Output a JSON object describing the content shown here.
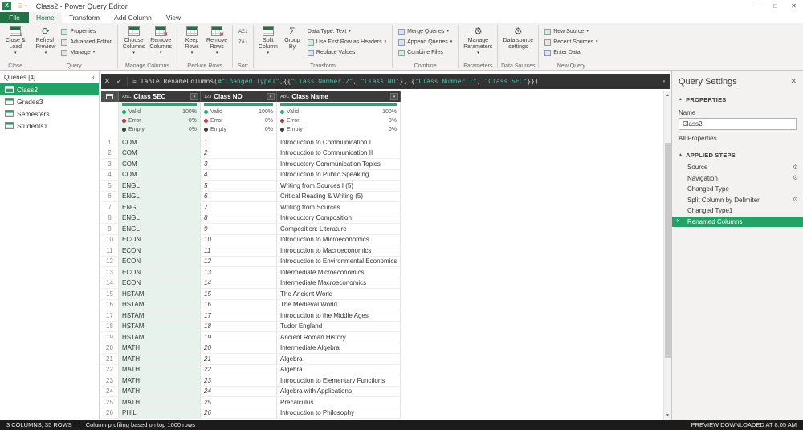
{
  "colors": {
    "accent_green": "#217346",
    "selection_green": "#21a366",
    "formula_string_teal": "#45c2a9",
    "valid_green": "#1aab6d",
    "error_red": "#c13838",
    "empty_dark": "#3b3b3b",
    "table_header_gray": "#3b3b3b"
  },
  "window": {
    "title": "Class2 - Power Query Editor"
  },
  "tabs": {
    "file": "File",
    "home": "Home",
    "transform": "Transform",
    "add_column": "Add Column",
    "view": "View"
  },
  "ribbon": {
    "close": {
      "label": "Close",
      "close_load": "Close &\nLoad"
    },
    "query": {
      "label": "Query",
      "refresh": "Refresh\nPreview",
      "properties": "Properties",
      "advanced_editor": "Advanced Editor",
      "manage": "Manage"
    },
    "manage_columns": {
      "label": "Manage Columns",
      "choose_columns": "Choose\nColumns",
      "remove_columns": "Remove\nColumns"
    },
    "reduce_rows": {
      "label": "Reduce Rows",
      "keep_rows": "Keep\nRows",
      "remove_rows": "Remove\nRows"
    },
    "sort": {
      "label": "Sort"
    },
    "transform": {
      "label": "Transform",
      "split_column": "Split\nColumn",
      "group_by": "Group\nBy",
      "data_type": "Data Type: Text",
      "use_first_row": "Use First Row as Headers",
      "replace_values": "Replace Values"
    },
    "combine": {
      "label": "Combine",
      "merge_queries": "Merge Queries",
      "append_queries": "Append Queries",
      "combine_files": "Combine Files"
    },
    "parameters": {
      "label": "Parameters",
      "manage_parameters": "Manage\nParameters"
    },
    "data_sources": {
      "label": "Data Sources",
      "data_source_settings": "Data source\nsettings"
    },
    "new_query": {
      "label": "New Query",
      "new_source": "New Source",
      "recent_sources": "Recent Sources",
      "enter_data": "Enter Data"
    }
  },
  "queries_pane": {
    "header": "Queries [4]",
    "items": [
      {
        "label": "Class2",
        "selected": true
      },
      {
        "label": "Grades3",
        "selected": false
      },
      {
        "label": "Semesters",
        "selected": false
      },
      {
        "label": "Students1",
        "selected": false
      }
    ]
  },
  "formula_bar": {
    "tokens": [
      {
        "text": "= Table.RenameColumns(",
        "type": "plain"
      },
      {
        "text": "#\"Changed Type1\"",
        "type": "string"
      },
      {
        "text": ",{{",
        "type": "plain"
      },
      {
        "text": "\"Class Number.2\"",
        "type": "string"
      },
      {
        "text": ", ",
        "type": "plain"
      },
      {
        "text": "\"Class NO\"",
        "type": "string"
      },
      {
        "text": "}, {",
        "type": "plain"
      },
      {
        "text": "\"Class Number.1\"",
        "type": "string"
      },
      {
        "text": ", ",
        "type": "plain"
      },
      {
        "text": "\"Class SEC\"",
        "type": "string"
      },
      {
        "text": "}})",
        "type": "plain"
      }
    ]
  },
  "table": {
    "quality_labels": {
      "valid": "Valid",
      "error": "Error",
      "empty": "Empty"
    },
    "columns": [
      {
        "type_label": "ABC",
        "name": "Class SEC",
        "valid": "100%",
        "error": "0%",
        "empty": "0%"
      },
      {
        "type_label": "123",
        "name": "Class NO",
        "valid": "100%",
        "error": "0%",
        "empty": "0%"
      },
      {
        "type_label": "ABC",
        "name": "Class Name",
        "valid": "100%",
        "error": "0%",
        "empty": "0%"
      }
    ],
    "rows": [
      {
        "n": 1,
        "sec": "COM",
        "no": "1",
        "name": "Introduction to Communication I"
      },
      {
        "n": 2,
        "sec": "COM",
        "no": "2",
        "name": "Introduction to Communication II"
      },
      {
        "n": 3,
        "sec": "COM",
        "no": "3",
        "name": "Introductory Communication Topics"
      },
      {
        "n": 4,
        "sec": "COM",
        "no": "4",
        "name": "Introduction to Public Speaking"
      },
      {
        "n": 5,
        "sec": "ENGL",
        "no": "5",
        "name": "Writing from Sources I (5)"
      },
      {
        "n": 6,
        "sec": "ENGL",
        "no": "6",
        "name": "Critical Reading & Writing (5)"
      },
      {
        "n": 7,
        "sec": "ENGL",
        "no": "7",
        "name": "Writing from Sources"
      },
      {
        "n": 8,
        "sec": "ENGL",
        "no": "8",
        "name": "Introductory Composition"
      },
      {
        "n": 9,
        "sec": "ENGL",
        "no": "9",
        "name": "Composition: Literature"
      },
      {
        "n": 10,
        "sec": "ECON",
        "no": "10",
        "name": "Introduction to Microeconomics"
      },
      {
        "n": 11,
        "sec": "ECON",
        "no": "11",
        "name": "Introduction to Macroeconomics"
      },
      {
        "n": 12,
        "sec": "ECON",
        "no": "12",
        "name": "Introduction to Environmental Economics"
      },
      {
        "n": 13,
        "sec": "ECON",
        "no": "13",
        "name": "Intermediate Microeconomics"
      },
      {
        "n": 14,
        "sec": "ECON",
        "no": "14",
        "name": "Intermediate Macroeconomics"
      },
      {
        "n": 15,
        "sec": "HSTAM",
        "no": "15",
        "name": "The Ancient World"
      },
      {
        "n": 16,
        "sec": "HSTAM",
        "no": "16",
        "name": "The Medieval World"
      },
      {
        "n": 17,
        "sec": "HSTAM",
        "no": "17",
        "name": "Introduction to the Middle Ages"
      },
      {
        "n": 18,
        "sec": "HSTAM",
        "no": "18",
        "name": "Tudor England"
      },
      {
        "n": 19,
        "sec": "HSTAM",
        "no": "19",
        "name": "Ancient Roman History"
      },
      {
        "n": 20,
        "sec": "MATH",
        "no": "20",
        "name": "Intermediate Algebra"
      },
      {
        "n": 21,
        "sec": "MATH",
        "no": "21",
        "name": "Algebra"
      },
      {
        "n": 22,
        "sec": "MATH",
        "no": "22",
        "name": "Algebra"
      },
      {
        "n": 23,
        "sec": "MATH",
        "no": "23",
        "name": "Introduction to Elementary Functions"
      },
      {
        "n": 24,
        "sec": "MATH",
        "no": "24",
        "name": "Algebra with Applications"
      },
      {
        "n": 25,
        "sec": "MATH",
        "no": "25",
        "name": "Precalculus"
      },
      {
        "n": 26,
        "sec": "PHIL",
        "no": "26",
        "name": "Introduction to Philosophy"
      }
    ]
  },
  "query_settings": {
    "title": "Query Settings",
    "properties_header": "PROPERTIES",
    "name_label": "Name",
    "name_value": "Class2",
    "all_properties": "All Properties",
    "applied_steps_header": "APPLIED STEPS",
    "steps": [
      {
        "label": "Source",
        "gear": true,
        "selected": false,
        "removable": false
      },
      {
        "label": "Navigation",
        "gear": true,
        "selected": false,
        "removable": false
      },
      {
        "label": "Changed Type",
        "gear": false,
        "selected": false,
        "removable": false
      },
      {
        "label": "Split Column by Delimiter",
        "gear": true,
        "selected": false,
        "removable": false
      },
      {
        "label": "Changed Type1",
        "gear": false,
        "selected": false,
        "removable": false
      },
      {
        "label": "Renamed Columns",
        "gear": false,
        "selected": true,
        "removable": true
      }
    ]
  },
  "status_bar": {
    "left_primary": "3 COLUMNS, 35 ROWS",
    "left_secondary": "Column profiling based on top 1000 rows",
    "right": "PREVIEW DOWNLOADED AT 8:05 AM"
  }
}
